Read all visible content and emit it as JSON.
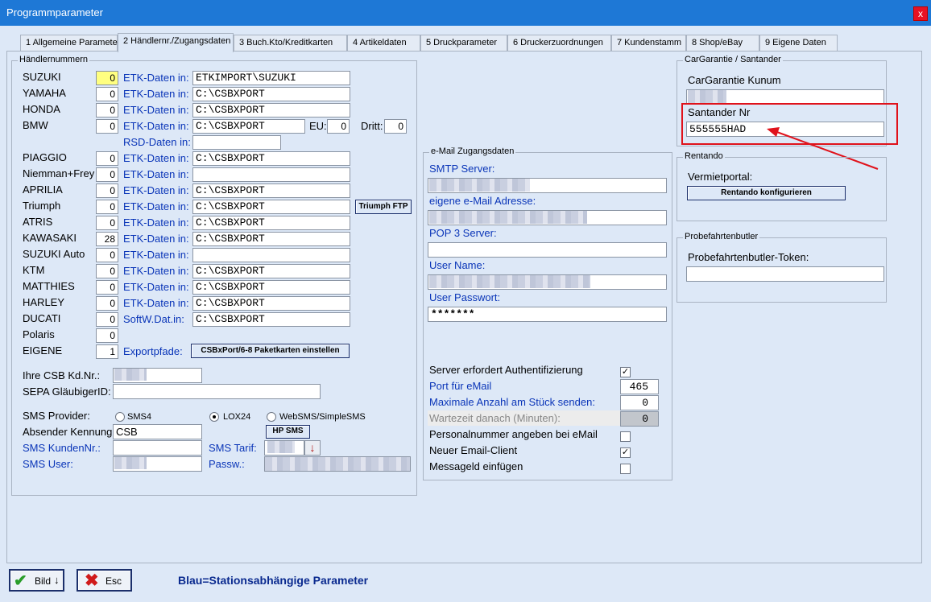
{
  "window": {
    "title": "Programmparameter",
    "close": "x"
  },
  "tabs": [
    {
      "label": "1 Allgemeine Parameter"
    },
    {
      "label": "2 Händlernr./Zugangsdaten"
    },
    {
      "label": "3 Buch.Kto/Kreditkarten"
    },
    {
      "label": "4 Artikeldaten"
    },
    {
      "label": "5 Druckparameter"
    },
    {
      "label": "6 Druckerzuordnungen"
    },
    {
      "label": "7 Kundenstamm"
    },
    {
      "label": "8 Shop/eBay"
    },
    {
      "label": "9 Eigene Daten"
    }
  ],
  "dealers": {
    "legend": "Händlernummern",
    "rows": [
      {
        "name": "SUZUKI",
        "num": "0",
        "path_label": "ETK-Daten in:",
        "path": "ETKIMPORT\\SUZUKI"
      },
      {
        "name": "YAMAHA",
        "num": "0",
        "path_label": "ETK-Daten in:",
        "path": "C:\\CSBXPORT"
      },
      {
        "name": "HONDA",
        "num": "0",
        "path_label": "ETK-Daten in:",
        "path": "C:\\CSBXPORT"
      },
      {
        "name": "BMW",
        "num": "0",
        "path_label": "ETK-Daten in:",
        "path": "C:\\CSBXPORT"
      },
      {
        "name": "PIAGGIO",
        "num": "0",
        "path_label": "ETK-Daten in:",
        "path": "C:\\CSBXPORT"
      },
      {
        "name": "Niemman+Frey",
        "num": "0",
        "path_label": "ETK-Daten in:",
        "path": ""
      },
      {
        "name": "APRILIA",
        "num": "0",
        "path_label": "ETK-Daten in:",
        "path": "C:\\CSBXPORT"
      },
      {
        "name": "Triumph",
        "num": "0",
        "path_label": "ETK-Daten in:",
        "path": "C:\\CSBXPORT"
      },
      {
        "name": "ATRIS",
        "num": "0",
        "path_label": "ETK-Daten in:",
        "path": "C:\\CSBXPORT"
      },
      {
        "name": "KAWASAKI",
        "num": "28",
        "path_label": "ETK-Daten in:",
        "path": "C:\\CSBXPORT"
      },
      {
        "name": "SUZUKI Auto",
        "num": "0",
        "path_label": "ETK-Daten in:",
        "path": ""
      },
      {
        "name": "KTM",
        "num": "0",
        "path_label": "ETK-Daten in:",
        "path": "C:\\CSBXPORT"
      },
      {
        "name": "MATTHIES",
        "num": "0",
        "path_label": "ETK-Daten in:",
        "path": "C:\\CSBXPORT"
      },
      {
        "name": "HARLEY",
        "num": "0",
        "path_label": "ETK-Daten in:",
        "path": "C:\\CSBXPORT"
      },
      {
        "name": "DUCATI",
        "num": "0",
        "path_label": "SoftW.Dat.in:",
        "path": "C:\\CSBXPORT"
      },
      {
        "name": "Polaris",
        "num": "0"
      },
      {
        "name": "EIGENE",
        "num": "1"
      }
    ],
    "rsd_label": "RSD-Daten in:",
    "eu_label": "EU:",
    "eu_value": "0",
    "dritt_label": "Dritt:",
    "dritt_value": "0",
    "triumph_ftp": "Triumph FTP",
    "export_label": "Exportpfade:",
    "export_button": "CSBxPort/6-8 Paketkarten einstellen",
    "csb_label": "Ihre CSB Kd.Nr.:",
    "sepa_label": "SEPA GläubigerID:",
    "sms_provider_label": "SMS Provider:",
    "sms_options": [
      "SMS4",
      "LOX24",
      "WebSMS/SimpleSMS"
    ],
    "sender_label": "Absender Kennung",
    "sender_value": "CSB",
    "hp_sms": "HP SMS",
    "sms_customer_label": "SMS KundenNr.:",
    "sms_tariff_label": "SMS Tarif:",
    "sms_user_label": "SMS User:",
    "sms_pass_label": "Passw.:"
  },
  "email": {
    "legend": "e-Mail Zugangsdaten",
    "smtp_label": "SMTP Server:",
    "address_label": "eigene e-Mail Adresse:",
    "pop3_label": "POP 3 Server:",
    "user_label": "User Name:",
    "password_label": "User Passwort:",
    "password_value": "*******",
    "auth_label": "Server erfordert Authentifizierung",
    "port_label": "Port für eMail",
    "port_value": "465",
    "max_label": "Maximale Anzahl am Stück senden:",
    "max_value": "0",
    "wait_label": "Wartezeit danach (Minuten):",
    "wait_value": "0",
    "personal_label": "Personalnummer angeben bei eMail",
    "client_label": "Neuer Email-Client",
    "messageld_label": "Messageld einfügen"
  },
  "cargarantie": {
    "legend": "CarGarantie / Santander",
    "kunum_label": "CarGarantie Kunum",
    "santander_label": "Santander Nr",
    "santander_value": "555555HAD"
  },
  "rentando": {
    "legend": "Rentando",
    "portal_label": "Vermietportal:",
    "button": "Rentando konfigurieren"
  },
  "probefahrt": {
    "legend": "Probefahrtenbutler",
    "token_label": "Probefahrtenbutler-Token:"
  },
  "footer": {
    "bild_label": "Bild",
    "esc_label": "Esc",
    "note": "Blau=Stationsabhängige Parameter"
  },
  "colors": {
    "blue_label": "#0a35b8",
    "title_bar": "#1e78d6",
    "annotation": "#e0121b"
  }
}
